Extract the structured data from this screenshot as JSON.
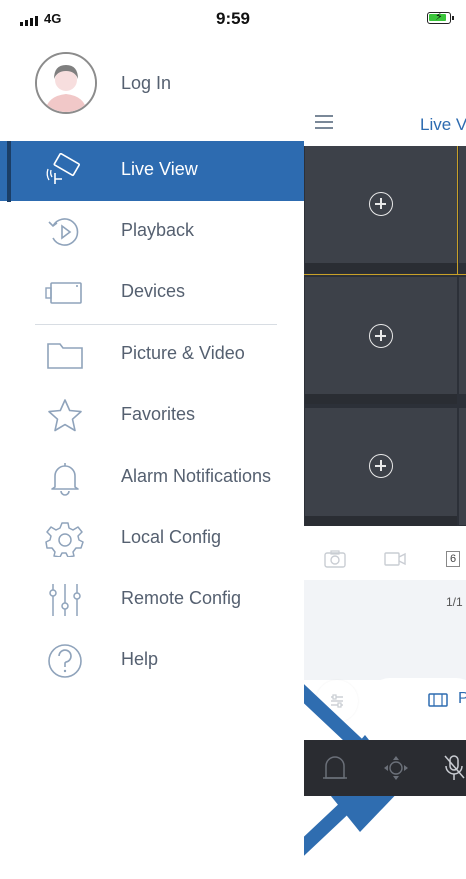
{
  "status_bar": {
    "signal": "4G",
    "time": "9:59"
  },
  "drawer": {
    "login_label": "Log In",
    "items": [
      {
        "label": "Live View",
        "icon": "camera-icon",
        "active": true
      },
      {
        "label": "Playback",
        "icon": "playback-icon",
        "active": false
      },
      {
        "label": "Devices",
        "icon": "device-icon",
        "active": false
      },
      {
        "label": "Picture & Video",
        "icon": "folder-icon",
        "active": false
      },
      {
        "label": "Favorites",
        "icon": "star-icon",
        "active": false
      },
      {
        "label": "Alarm Notifications",
        "icon": "bell-icon",
        "active": false
      },
      {
        "label": "Local Config",
        "icon": "gear-icon",
        "active": false
      },
      {
        "label": "Remote Config",
        "icon": "sliders-icon",
        "active": false
      },
      {
        "label": "Help",
        "icon": "help-icon",
        "active": false
      }
    ]
  },
  "live_view": {
    "title": "Live V",
    "page_indicator": "1/1",
    "split_count": "6",
    "colors": {
      "accent": "#2d6bb0",
      "grid": "#3d4149",
      "selected_border": "#c8a028"
    }
  }
}
